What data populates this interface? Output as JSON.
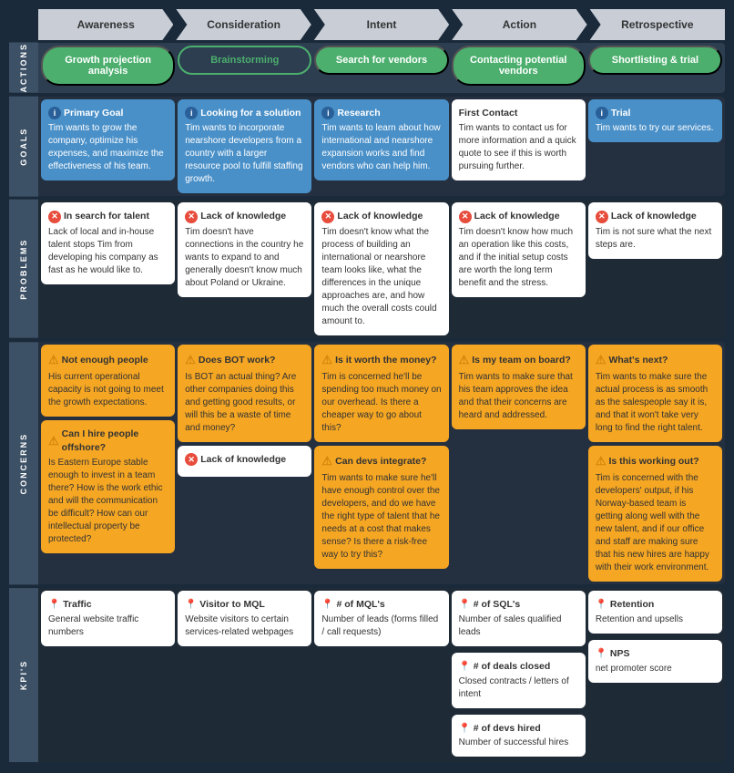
{
  "header": {
    "stages": [
      {
        "label": "Awareness"
      },
      {
        "label": "Consideration"
      },
      {
        "label": "Intent"
      },
      {
        "label": "Action"
      },
      {
        "label": "Retrospective"
      }
    ]
  },
  "rows": {
    "actions": {
      "label": "ACTIONS",
      "cols": [
        {
          "type": "green",
          "text": "Growth projection analysis"
        },
        {
          "type": "outline",
          "text": "Brainstorming"
        },
        {
          "type": "green",
          "text": "Search for vendors"
        },
        {
          "type": "green",
          "text": "Contacting potential vendors"
        },
        {
          "type": "green",
          "text": "Shortlisting & trial"
        }
      ]
    },
    "goals": {
      "label": "GOALS",
      "cols": [
        {
          "title": "Primary Goal",
          "icon": "info",
          "style": "blue",
          "body": "Tim wants to grow the company, optimize his expenses, and maximize the effectiveness of his team."
        },
        {
          "title": "Looking for a solution",
          "icon": "info",
          "style": "blue",
          "body": "Tim wants to incorporate nearshore developers from a country with a larger resource pool to fulfill staffing growth."
        },
        {
          "title": "Research",
          "icon": "info",
          "style": "blue",
          "body": "Tim wants to learn about how international and nearshore expansion works and find vendors who can help him."
        },
        {
          "title": "First Contact",
          "icon": "none",
          "style": "white",
          "body": "Tim wants to contact us for more information and a quick quote to see if this is worth pursuing further."
        },
        {
          "title": "Trial",
          "icon": "info",
          "style": "blue",
          "body": "Tim wants to try our services."
        }
      ]
    },
    "problems": {
      "label": "PROBLEMS",
      "cols": [
        {
          "title": "In search for talent",
          "icon": "x",
          "style": "white",
          "body": "Lack of local and in-house talent stops Tim from developing his company as fast as he would like to."
        },
        {
          "title": "Lack of knowledge",
          "icon": "x",
          "style": "white",
          "body": "Tim doesn't have connections in the country he wants to expand to and generally doesn't know much about Poland or Ukraine."
        },
        {
          "title": "Lack of knowledge",
          "icon": "x",
          "style": "white",
          "body": "Tim doesn't know what the process of building an international or nearshore team looks like, what the differences in the unique approaches are, and how much the overall costs could amount to."
        },
        {
          "title": "Lack of knowledge",
          "icon": "x",
          "style": "white",
          "body": "Tim doesn't know how much an operation like this costs, and if the initial setup costs are worth the long term benefit and the stress."
        },
        {
          "title": "Lack of knowledge",
          "icon": "x",
          "style": "white",
          "body": "Tim is not sure what the next steps are."
        }
      ]
    },
    "concerns": {
      "label": "CONCERNS",
      "cols": [
        {
          "cards": [
            {
              "title": "Not enough people",
              "icon": "warning",
              "style": "orange",
              "body": "His current operational capacity is not going to meet the growth expectations."
            },
            {
              "title": "Can I hire people offshore?",
              "icon": "warning",
              "style": "orange",
              "body": "Is Eastern Europe stable enough to invest in a team there? How is the work ethic and will the communication be difficult? How can our intellectual property be protected?"
            }
          ]
        },
        {
          "cards": [
            {
              "title": "Does BOT work?",
              "icon": "warning",
              "style": "orange",
              "body": "Is BOT an actual thing? Are other companies doing this and getting good results, or will this be a waste of time and money?"
            },
            {
              "title": "Lack of knowledge",
              "icon": "none",
              "style": "white",
              "body": ""
            }
          ]
        },
        {
          "cards": [
            {
              "title": "Is it worth the money?",
              "icon": "warning",
              "style": "orange",
              "body": "Tim is concerned he'll be spending too much money on our overhead. Is there a cheaper way to go about this?"
            },
            {
              "title": "Can devs integrate?",
              "icon": "warning",
              "style": "orange",
              "body": "Tim wants to make sure he'll have enough control over the developers, and do we have the right type of talent that he needs at a cost that makes sense? Is there a risk-free way to try this?"
            }
          ]
        },
        {
          "cards": [
            {
              "title": "Is my team on board?",
              "icon": "warning",
              "style": "orange",
              "body": "Tim wants to make sure that his team approves the idea and that their concerns are heard and addressed."
            }
          ]
        },
        {
          "cards": [
            {
              "title": "What's next?",
              "icon": "warning",
              "style": "orange",
              "body": "Tim wants to make sure the actual process is as smooth as the salespeople say it is, and that it won't take very long to find the right talent."
            },
            {
              "title": "Is this working out?",
              "icon": "warning",
              "style": "orange",
              "body": "Tim is concerned with the developers' output, if his Norway-based team is getting along well with the new talent, and if our office and staff are making sure that his new hires are happy with their work environment."
            }
          ]
        }
      ]
    },
    "kpis": {
      "label": "KPI'S",
      "cols": [
        {
          "cards": [
            {
              "title": "Traffic",
              "icon": "pin",
              "body": "General website traffic numbers"
            }
          ]
        },
        {
          "cards": [
            {
              "title": "Visitor to MQL",
              "icon": "pin",
              "body": "Website visitors to certain services-related webpages"
            }
          ]
        },
        {
          "cards": [
            {
              "title": "# of MQL's",
              "icon": "pin",
              "body": "Number of leads (forms filled / call requests)"
            }
          ]
        },
        {
          "cards": [
            {
              "title": "# of SQL's",
              "icon": "pin",
              "body": "Number of sales qualified leads"
            },
            {
              "title": "# of deals closed",
              "icon": "pin",
              "body": "Closed contracts / letters of intent"
            },
            {
              "title": "# of devs hired",
              "icon": "pin",
              "body": "Number of successful hires"
            }
          ]
        },
        {
          "cards": [
            {
              "title": "Retention",
              "icon": "pin",
              "body": "Retention and upsells"
            },
            {
              "title": "NPS",
              "icon": "pin",
              "body": "net promoter score"
            }
          ]
        }
      ]
    }
  }
}
